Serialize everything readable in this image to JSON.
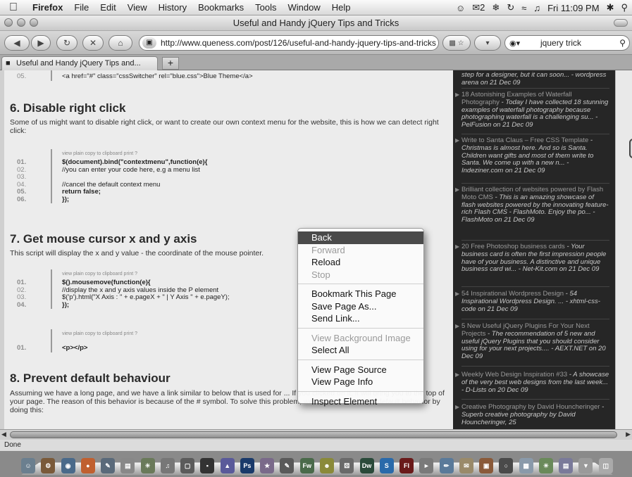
{
  "os_menubar": {
    "app": "Firefox",
    "menus": [
      "File",
      "Edit",
      "View",
      "History",
      "Bookmarks",
      "Tools",
      "Window",
      "Help"
    ],
    "mail_count": "2",
    "clock": "Fri 11:09 PM"
  },
  "window": {
    "title": "Useful and Handy jQuery Tips and Tricks"
  },
  "navigation": {
    "url": "http://www.queness.com/post/126/useful-and-handy-jquery-tips-and-tricks",
    "search_value": "jquery trick"
  },
  "tabs": [
    {
      "label": "Useful and Handy jQuery Tips and..."
    }
  ],
  "article": {
    "top_line_number": "05.",
    "top_code": "<a href=\"#\" class=\"cssSwitcher\" rel=\"blue.css\">Blue Theme</a>",
    "sections": [
      {
        "heading": "6. Disable right click",
        "text": "Some of us might want to disable right click, or want to create our own context menu for the website, this is how we can detect right click:",
        "code_tools": "view plain   copy to clipboard   print   ?",
        "lines": [
          {
            "n": "01.",
            "code": "$(document).bind(\"contextmenu\",function(e){"
          },
          {
            "n": "02.",
            "code": "    //you can enter your code here, e.g a menu list"
          },
          {
            "n": "03.",
            "code": ""
          },
          {
            "n": "04.",
            "code": "    //cancel the default context menu"
          },
          {
            "n": "05.",
            "code": "    return false;"
          },
          {
            "n": "06.",
            "code": "});"
          }
        ]
      },
      {
        "heading": "7. Get mouse cursor x and y axis",
        "text": "This script will display the x and y value - the coordinate of the mouse pointer.",
        "code_tools": "view plain   copy to clipboard   print   ?",
        "lines": [
          {
            "n": "01.",
            "code": "$().mousemove(function(e){"
          },
          {
            "n": "02.",
            "code": "    //display the x and y axis values inside the P element"
          },
          {
            "n": "03.",
            "code": "    $('p').html(\"X Axis : \" + e.pageX + \" | Y Axis \" + e.pageY);"
          },
          {
            "n": "04.",
            "code": "});"
          }
        ],
        "code_tools_2": "view plain   copy to clipboard   print   ?",
        "lines_2": [
          {
            "n": "01.",
            "code": "<p></p>"
          }
        ]
      },
      {
        "heading": "8. Prevent default behaviour",
        "text": "Assuming we have a long page, and we have a link similar to below that is used for ... If you clicked on it, it will bring you to the top of your page. The reason of this behavior is because of the # symbol. To solve this problem, we need to cancel the default behavior by doing this:"
      }
    ]
  },
  "sidebar": {
    "items": [
      {
        "title": "",
        "desc": "step for a designer, but it can soon... - wordpress arena on 21 Dec 09"
      },
      {
        "title": "18 Astonishing Examples of Waterfall Photography",
        "desc": " - Today I have collected 18 stunning examples of waterfall photography because photographing waterfall is a challenging su... - PelFusion on 21 Dec 09"
      },
      {
        "title": "Write to Santa Claus – Free CSS Template",
        "desc": " - Christmas is almost here. And so is Santa. Children want gifts and most of them write to Santa. We come up with a new n... - Indeziner.com on 21 Dec 09"
      },
      {
        "title": "Brilliant collection of websites powered by Flash Moto CMS",
        "desc": " - This is an amazing showcase of flash websites powered by the innovating feature-rich Flash CMS - FlashMoto. Enjoy the po... - FlashMoto on 21 Dec 09"
      },
      {
        "title": "20 Free Photoshop business cards",
        "desc": " - Your business card is often the first impression people have of your business. A distinctive and unique business card wi... - Net-Kit.com on 21 Dec 09"
      },
      {
        "title": "54 Inspirational Wordpress Design",
        "desc": " - 54 Inspirational Wordpress Design. ... - xhtml-css-code on 21 Dec 09"
      },
      {
        "title": "5 New Useful jQuery Plugins For Your Next Projects",
        "desc": " - The recommendation of 5 new and useful jQuery Plugins that you should consider using for your next projects.... - AEXT.NET on 20 Dec 09"
      },
      {
        "title": "Weekly Web Design Inspiration #33",
        "desc": " - A showcase of the very best web designs from the last week... - D-Lists on 20 Dec 09"
      },
      {
        "title": "Creative Photography by David Houncheringer",
        "desc": " - Superb creative photography by David Houncheringer, 25"
      }
    ]
  },
  "context_menu": {
    "items": [
      {
        "label": "Back",
        "state": "highlighted"
      },
      {
        "label": "Forward",
        "state": "disabled"
      },
      {
        "label": "Reload",
        "state": "enabled"
      },
      {
        "label": "Stop",
        "state": "disabled"
      },
      {
        "label": "Bookmark This Page",
        "state": "enabled"
      },
      {
        "label": "Save Page As...",
        "state": "enabled"
      },
      {
        "label": "Send Link...",
        "state": "enabled"
      },
      {
        "label": "View Background Image",
        "state": "disabled"
      },
      {
        "label": "Select All",
        "state": "enabled"
      },
      {
        "label": "View Page Source",
        "state": "enabled"
      },
      {
        "label": "View Page Info",
        "state": "enabled"
      },
      {
        "label": "Inspect Element",
        "state": "enabled"
      }
    ]
  },
  "status": {
    "text": "Done"
  },
  "dock": {
    "labels": [
      "Ps",
      "Fw",
      "Dw",
      "S",
      "Fl"
    ]
  },
  "colors": {
    "highlight": "#4a4a4a",
    "sidebar_bg": "#262626"
  }
}
